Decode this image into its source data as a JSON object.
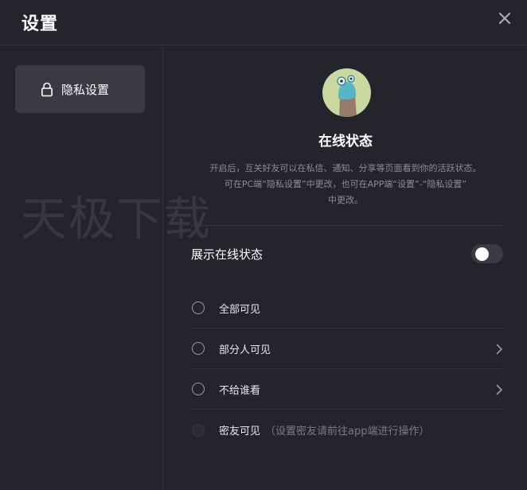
{
  "header": {
    "title": "设置",
    "close_icon": "close-icon"
  },
  "sidebar": {
    "items": [
      {
        "label": "隐私设置",
        "icon": "lock-icon",
        "selected": true
      }
    ]
  },
  "watermark": "天极下载",
  "main": {
    "status_title": "在线状态",
    "description": [
      "开启后，互关好友可以在私信、通知、分享等页面看到你的活跃状态。",
      "可在PC端“隐私设置”中更改，也可在APP端“设置”-“隐私设置”",
      "中更改。"
    ],
    "toggle": {
      "label": "展示在线状态",
      "on": false
    },
    "options": [
      {
        "label": "全部可见",
        "note": "",
        "has_chevron": false,
        "disabled": false
      },
      {
        "label": "部分人可见",
        "note": "",
        "has_chevron": true,
        "disabled": false
      },
      {
        "label": "不给谁看",
        "note": "",
        "has_chevron": true,
        "disabled": false
      },
      {
        "label": "密友可见",
        "note": "（设置密友请前往app端进行操作）",
        "has_chevron": false,
        "disabled": true
      }
    ]
  },
  "colors": {
    "background": "#24242d",
    "selected_item": "#3a3a44",
    "muted_text": "#8d8d98",
    "avatar_bg": "#c9d9a0"
  }
}
